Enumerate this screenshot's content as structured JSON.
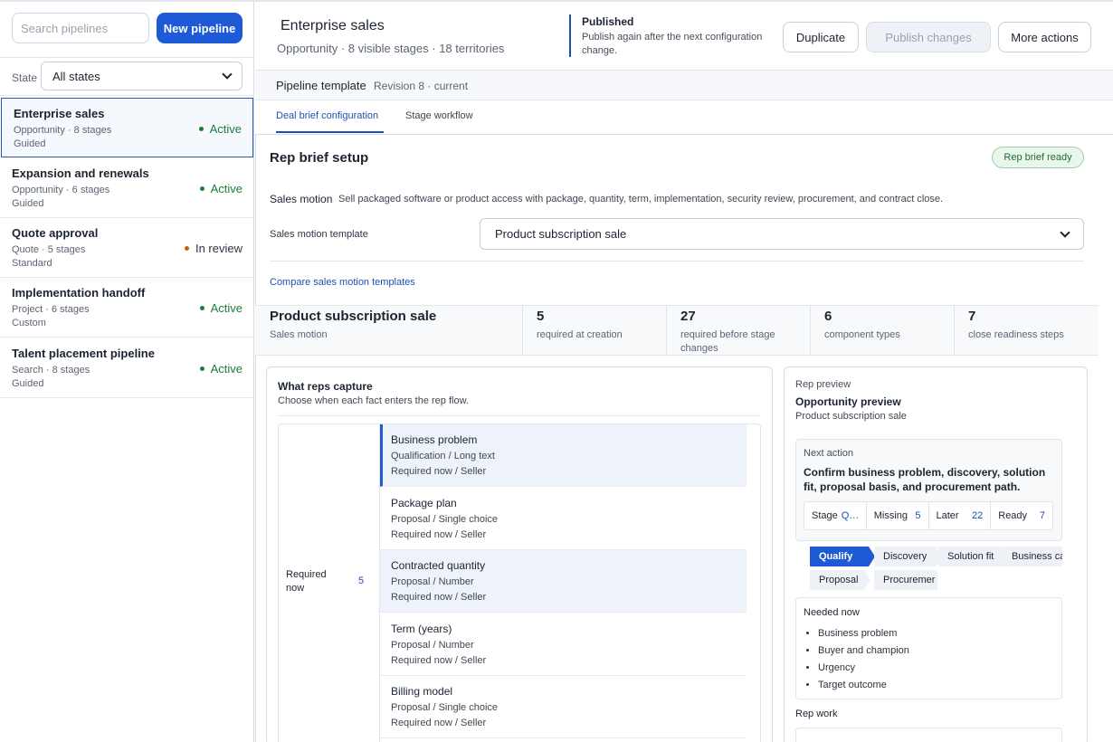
{
  "sidebar": {
    "search_placeholder": "Search pipelines",
    "new_button": "New pipeline",
    "state_label": "State",
    "state_value": "All states",
    "pipelines": [
      {
        "name": "Enterprise sales",
        "sub": "Opportunity · 8 stages",
        "mode": "Guided",
        "status": "Active",
        "status_type": "active"
      },
      {
        "name": "Expansion and renewals",
        "sub": "Opportunity · 6 stages",
        "mode": "Guided",
        "status": "Active",
        "status_type": "active"
      },
      {
        "name": "Quote approval",
        "sub": "Quote · 5 stages",
        "mode": "Standard",
        "status": "In review",
        "status_type": "review"
      },
      {
        "name": "Implementation handoff",
        "sub": "Project · 6 stages",
        "mode": "Custom",
        "status": "Active",
        "status_type": "active"
      },
      {
        "name": "Talent placement pipeline",
        "sub": "Search · 8 stages",
        "mode": "Guided",
        "status": "Active",
        "status_type": "active"
      }
    ]
  },
  "header": {
    "title": "Enterprise sales",
    "subtitle": "Opportunity · 8 visible stages · 18 territories",
    "publish_title": "Published",
    "publish_text": "Publish again after the next configuration change.",
    "duplicate": "Duplicate",
    "publish_changes": "Publish changes",
    "more_actions": "More actions"
  },
  "template": {
    "title": "Pipeline template",
    "revision": "Revision 8 · current"
  },
  "tabs": [
    "Deal brief configuration",
    "Stage workflow"
  ],
  "brief": {
    "title": "Rep brief setup",
    "badge": "Rep brief ready",
    "sales_motion_label": "Sales motion",
    "sales_motion_desc": "Sell packaged software or product access with package, quantity, term, implementation, security review, procurement, and contract close.",
    "template_label": "Sales motion template",
    "template_value": "Product subscription sale",
    "compare_link": "Compare sales motion templates"
  },
  "stats": [
    {
      "value": "Product subscription sale",
      "label": "Sales motion"
    },
    {
      "value": "5",
      "label": "required at creation"
    },
    {
      "value": "27",
      "label": "required before stage changes"
    },
    {
      "value": "6",
      "label": "component types"
    },
    {
      "value": "7",
      "label": "close readiness steps"
    }
  ],
  "capture": {
    "title": "What reps capture",
    "subtitle": "Choose when each fact enters the rep flow.",
    "group_label": "Required now",
    "group_count": "5",
    "fields": [
      {
        "name": "Business problem",
        "meta": "Qualification / Long text",
        "req": "Required now / Seller"
      },
      {
        "name": "Package plan",
        "meta": "Proposal / Single choice",
        "req": "Required now / Seller"
      },
      {
        "name": "Contracted quantity",
        "meta": "Proposal / Number",
        "req": "Required now / Seller"
      },
      {
        "name": "Term (years)",
        "meta": "Proposal / Number",
        "req": "Required now / Seller"
      },
      {
        "name": "Billing model",
        "meta": "Proposal / Single choice",
        "req": "Required now / Seller"
      }
    ]
  },
  "preview": {
    "label": "Rep preview",
    "title": "Opportunity preview",
    "subtitle": "Product subscription sale",
    "next_action_label": "Next action",
    "next_action_text": "Confirm business problem, discovery, solution fit, proposal basis, and procurement path.",
    "kpis": [
      {
        "label": "Stage",
        "value": "Q…"
      },
      {
        "label": "Missing",
        "value": "5"
      },
      {
        "label": "Later",
        "value": "22"
      },
      {
        "label": "Ready",
        "value": "7"
      }
    ],
    "stages": [
      "Qualify",
      "Discovery",
      "Solution fit",
      "Business ca",
      "Proposal",
      "Procuremer"
    ],
    "needed_title": "Needed now",
    "needed_items": [
      "Business problem",
      "Buyer and champion",
      "Urgency",
      "Target outcome"
    ],
    "rep_work": "Rep work"
  },
  "colors": {
    "accent": "#1f5ad6",
    "active_status": "#1e7b3a",
    "review_status": "#c4600e"
  }
}
